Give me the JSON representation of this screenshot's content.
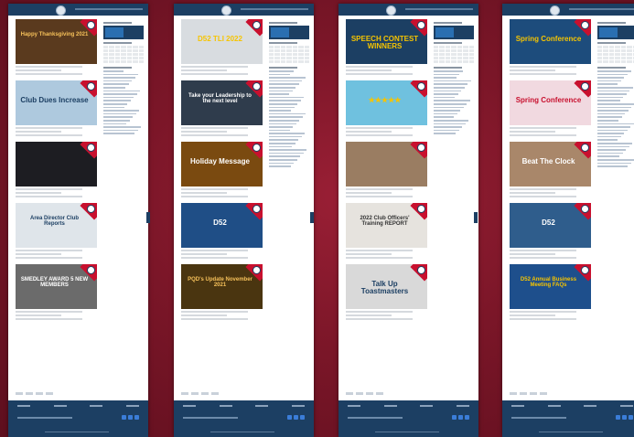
{
  "pages": [
    {
      "posts": [
        {
          "caption": "Happy Thanksgiving 2021",
          "bg": "#5a3a1e",
          "fg": "#f6c15a"
        },
        {
          "caption": "Club Dues Increase",
          "bg": "#aec9de",
          "fg": "#1c3f63"
        },
        {
          "caption": "",
          "bg": "#1d1d22",
          "fg": "#e37aa2"
        },
        {
          "caption": "Area Director Club Reports",
          "bg": "#dfe5ea",
          "fg": "#1c3f63"
        },
        {
          "caption": "SMEDLEY AWARD 5 NEW MEMBERS",
          "bg": "#6b6b6b",
          "fg": "#ffffff"
        }
      ]
    },
    {
      "posts": [
        {
          "caption": "D52 TLI 2022",
          "bg": "#d8dce0",
          "fg": "#f6c400"
        },
        {
          "caption": "Take your Leadership to the next level",
          "bg": "#2f3c4c",
          "fg": "#ffffff"
        },
        {
          "caption": "Holiday Message",
          "bg": "#7a4a10",
          "fg": "#ffffff"
        },
        {
          "caption": "D52",
          "bg": "#1f4e86",
          "fg": "#ffffff"
        },
        {
          "caption": "PQD's Update November 2021",
          "bg": "#4a3510",
          "fg": "#f6c15a"
        }
      ]
    },
    {
      "posts": [
        {
          "caption": "SPEECH CONTEST WINNERS",
          "bg": "#1c3f63",
          "fg": "#f6c400"
        },
        {
          "caption": "★★★★★",
          "bg": "#6fc1df",
          "fg": "#f6c400"
        },
        {
          "caption": "",
          "bg": "#9a7d62",
          "fg": "#ffffff"
        },
        {
          "caption": "2022 Club Officers' Training REPORT",
          "bg": "#e6e3de",
          "fg": "#333333"
        },
        {
          "caption": "Talk Up Toastmasters",
          "bg": "#d9d9d9",
          "fg": "#1c3f63"
        }
      ]
    },
    {
      "posts": [
        {
          "caption": "Spring Conference",
          "bg": "#1d4c7c",
          "fg": "#f6c400"
        },
        {
          "caption": "Spring Conference",
          "bg": "#f1d9e0",
          "fg": "#c8102e"
        },
        {
          "caption": "Beat The Clock",
          "bg": "#a9876a",
          "fg": "#ffffff"
        },
        {
          "caption": "D52",
          "bg": "#2f5d8c",
          "fg": "#ffffff"
        },
        {
          "caption": "D52 Annual Business Meeting FAQs",
          "bg": "#1e4f8c",
          "fg": "#f6c400"
        }
      ]
    }
  ]
}
